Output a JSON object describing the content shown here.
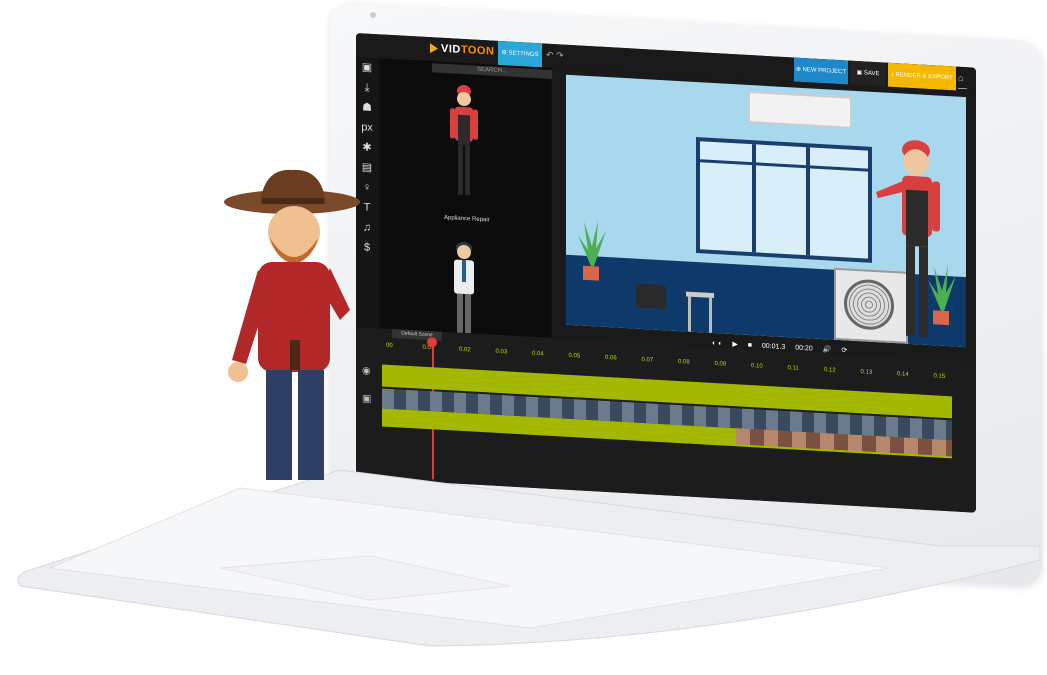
{
  "app": {
    "logo_prefix": "VID",
    "logo_suffix": "TOON",
    "settings_label": "SETTINGS",
    "new_project_label": "NEW PROJECT",
    "save_label": "SAVE",
    "render_label": "RENDER & EXPORT",
    "window_controls": "⌂ — ⏻"
  },
  "library": {
    "search_placeholder": "SEARCH...",
    "item_label": "Appliance Repair"
  },
  "tools": [
    "image-icon",
    "download-icon",
    "person-icon",
    "px-icon",
    "bug-icon",
    "document-icon",
    "microphone-icon",
    "text-icon",
    "music-icon",
    "dollar-icon"
  ],
  "player": {
    "current_time": "00:01.3",
    "total_time": "00:20"
  },
  "timeline": {
    "scene_tab": "Default Scene",
    "ticks": [
      "00",
      "0.01",
      "0.02",
      "0.03",
      "0.04",
      "0.05",
      "0.06",
      "0.07",
      "0.08",
      "0.09",
      "0.10",
      "0.11",
      "0.12",
      "0.13",
      "0.14",
      "0.15"
    ]
  }
}
